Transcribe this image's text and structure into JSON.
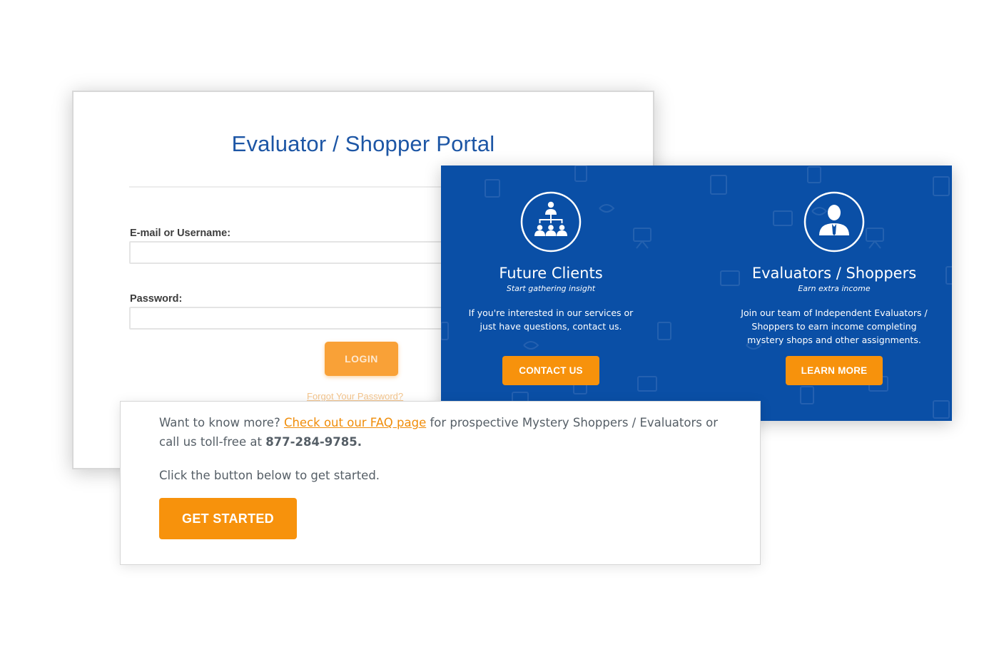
{
  "login_portal": {
    "title": "Evaluator / Shopper Portal",
    "email_label": "E-mail or Username:",
    "email_value": "",
    "password_label": "Password:",
    "password_value": "",
    "login_button": "LOGIN",
    "forgot_password": "Forgot Your Password?"
  },
  "promo": {
    "background_color": "#0a4fa6",
    "clients": {
      "icon": "org-chart-icon",
      "title": "Future Clients",
      "subtitle": "Start gathering insight",
      "text": "If you're interested in our services or just have questions, contact us.",
      "button": "CONTACT US"
    },
    "shoppers": {
      "icon": "business-person-icon",
      "title": "Evaluators / Shoppers",
      "subtitle": "Earn extra income",
      "text": "Join our team of Independent Evaluators / Shoppers to earn income completing mystery shops and other assignments.",
      "button": "LEARN MORE"
    }
  },
  "info": {
    "intro": "Want to know more?",
    "faq_link": "Check out our FAQ page",
    "middle": "for prospective Mystery Shoppers / Evaluators or call us toll-free at",
    "phone": "877-284-9785.",
    "cta_text": "Click the button below to get started.",
    "button": "GET STARTED"
  },
  "colors": {
    "accent_orange": "#f7920c",
    "portal_blue": "#1d56a5",
    "text_gray": "#555e66"
  }
}
